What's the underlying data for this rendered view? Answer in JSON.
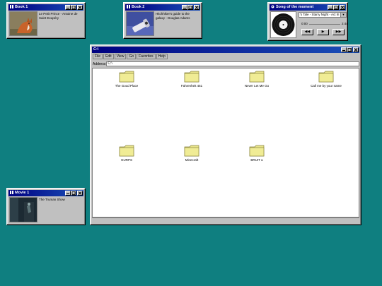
{
  "cards": {
    "book1": {
      "title": "Book 1",
      "text": "Le Petit Prince - Antoine de Saint Exupéry"
    },
    "book2": {
      "title": "Book 2",
      "text": "Hitchhiker's guide to the galaxy - Douglas Adams"
    },
    "movie1": {
      "title": "Movie 1",
      "text": "The Truman Show"
    }
  },
  "song": {
    "title": "Song of the moment",
    "selected": "'s Tale - Starry Night - Act III",
    "time_current": "0:00",
    "time_total": "2:44",
    "buttons": {
      "rewind": "◀◀",
      "play": "▶",
      "forward": "▶▶"
    }
  },
  "explorer": {
    "title": "C:\\",
    "menu": [
      "File",
      "Edit",
      "View",
      "Go",
      "Favorites",
      "Help"
    ],
    "address_label": "Address",
    "address_value": "C:\\",
    "folders": [
      "The Good Place",
      "Fahrenheit 451",
      "Never Let Me Go",
      "Call me by your name",
      "GURPS",
      "Minecraft",
      "BRUIT ≤"
    ]
  },
  "colors": {
    "desktop": "#0f7f80",
    "titlebar": "#000080",
    "folder": "#e8e48a"
  }
}
